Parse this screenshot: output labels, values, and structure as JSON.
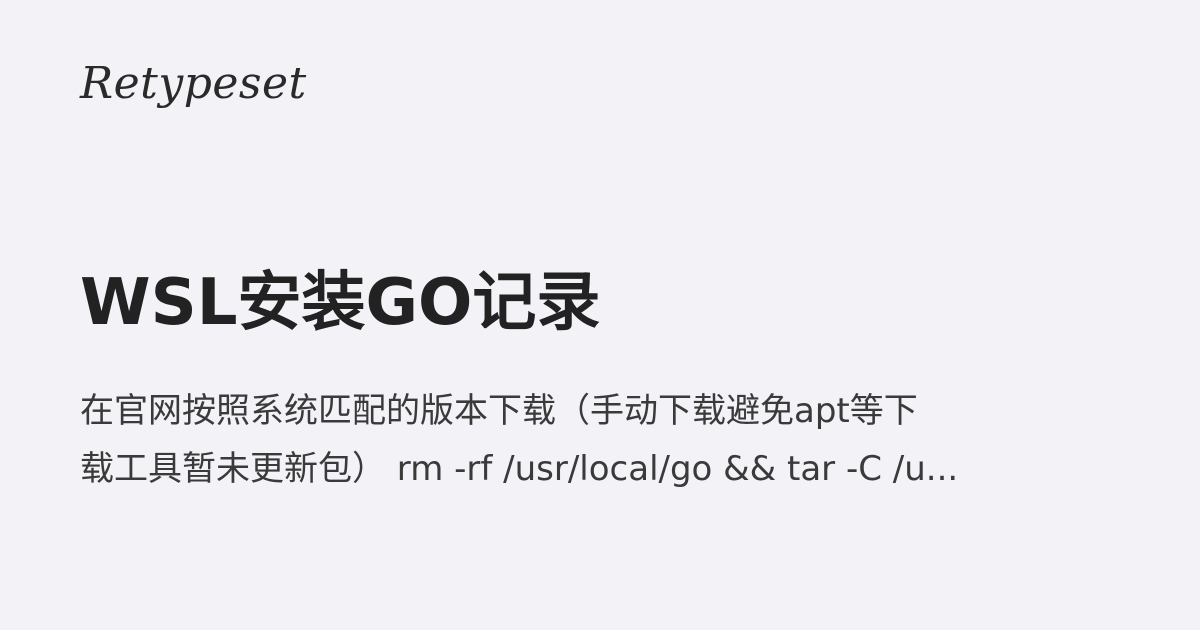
{
  "site": {
    "logo_text": "Retypeset"
  },
  "post": {
    "title": "WSL安装GO记录",
    "excerpt_line1": "在官网按照系统匹配的版本下载（手动下载避免apt等下",
    "excerpt_line2": "载工具暂未更新包） rm -rf /usr/local/go && tar -C /u..."
  },
  "colors": {
    "background": "#f2f2f7",
    "title": "#222222",
    "body_text": "#3a3a3a"
  }
}
